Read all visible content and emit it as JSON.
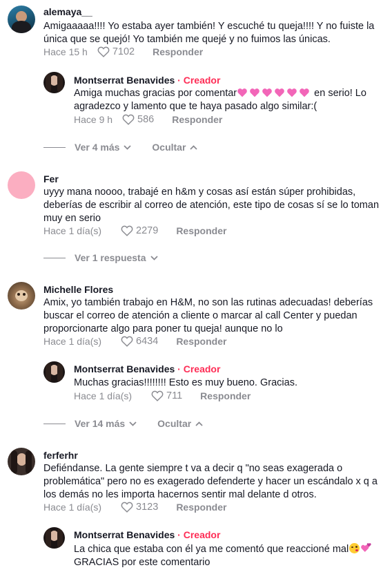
{
  "colors": {
    "creator": "#fe2c55",
    "meta": "#8a8b91",
    "heart_emoji": "#f266b8"
  },
  "comments": [
    {
      "username": "alemaya__",
      "text": "Amigaaaaa!!!! Yo estaba ayer también! Y escuché tu queja!!!! Y no fuiste la única que se quejó! Yo también me quejé y no fuimos las únicas.",
      "time": "Hace 15 h",
      "likes": "7102",
      "reply_label": "Responder",
      "avatar_icon": "avatar-photo"
    },
    {
      "username": "Montserrat Benavides",
      "creator_label": "· Creador",
      "text_before": "Amiga muchas gracias por comentar",
      "emoji": "pink-heart x6",
      "text_after": " en serio! Lo agradezco y lamento que te haya pasado algo similar:(",
      "time": "Hace 9 h",
      "likes": "586",
      "reply_label": "Responder"
    },
    {
      "username": "Fer",
      "text": "uyyy mana noooo, trabajé en h&m y cosas así están súper prohibidas, deberías de escribir al correo de atención, este tipo de cosas sí se lo toman muy en serio",
      "time": "Hace 1 día(s)",
      "likes": "2279",
      "reply_label": "Responder"
    },
    {
      "username": "Michelle Flores",
      "text": "Amix, yo también trabajo en H&M, no son las rutinas adecuadas! deberías buscar el correo de atención a cliente o marcar al call Center y puedan proporcionarte algo para poner tu queja! aunque no lo",
      "time": "Hace 1 día(s)",
      "likes": "6434",
      "reply_label": "Responder"
    },
    {
      "username": "Montserrat Benavides",
      "creator_label": "· Creador",
      "text": "Muchas gracias!!!!!!!! Esto es muy bueno. Gracias.",
      "time": "Hace 1 día(s)",
      "likes": "711",
      "reply_label": "Responder"
    },
    {
      "username": "ferferhr",
      "text": "Defiéndanse. La gente siempre t va a decir q \"no seas exagerada o problemática\" pero no es exagerado defenderte y hacer un escándalo x q a los demás no les importa hacernos sentir mal delante d otros.",
      "time": "Hace 1 día(s)",
      "likes": "3123",
      "reply_label": "Responder"
    },
    {
      "username": "Montserrat Benavides",
      "creator_label": "· Creador",
      "text": "La chica que estaba con él ya me comentó que reaccioné mal",
      "emoji": "kissing-face, revolving-hearts",
      "text_line2": "GRACIAS por este comentario"
    }
  ],
  "view_rows": [
    {
      "view_label": "Ver 4 más",
      "hide_label": "Ocultar"
    },
    {
      "view_label": "Ver 1 respuesta"
    },
    {
      "view_label": "Ver 14 más",
      "hide_label": "Ocultar"
    }
  ]
}
